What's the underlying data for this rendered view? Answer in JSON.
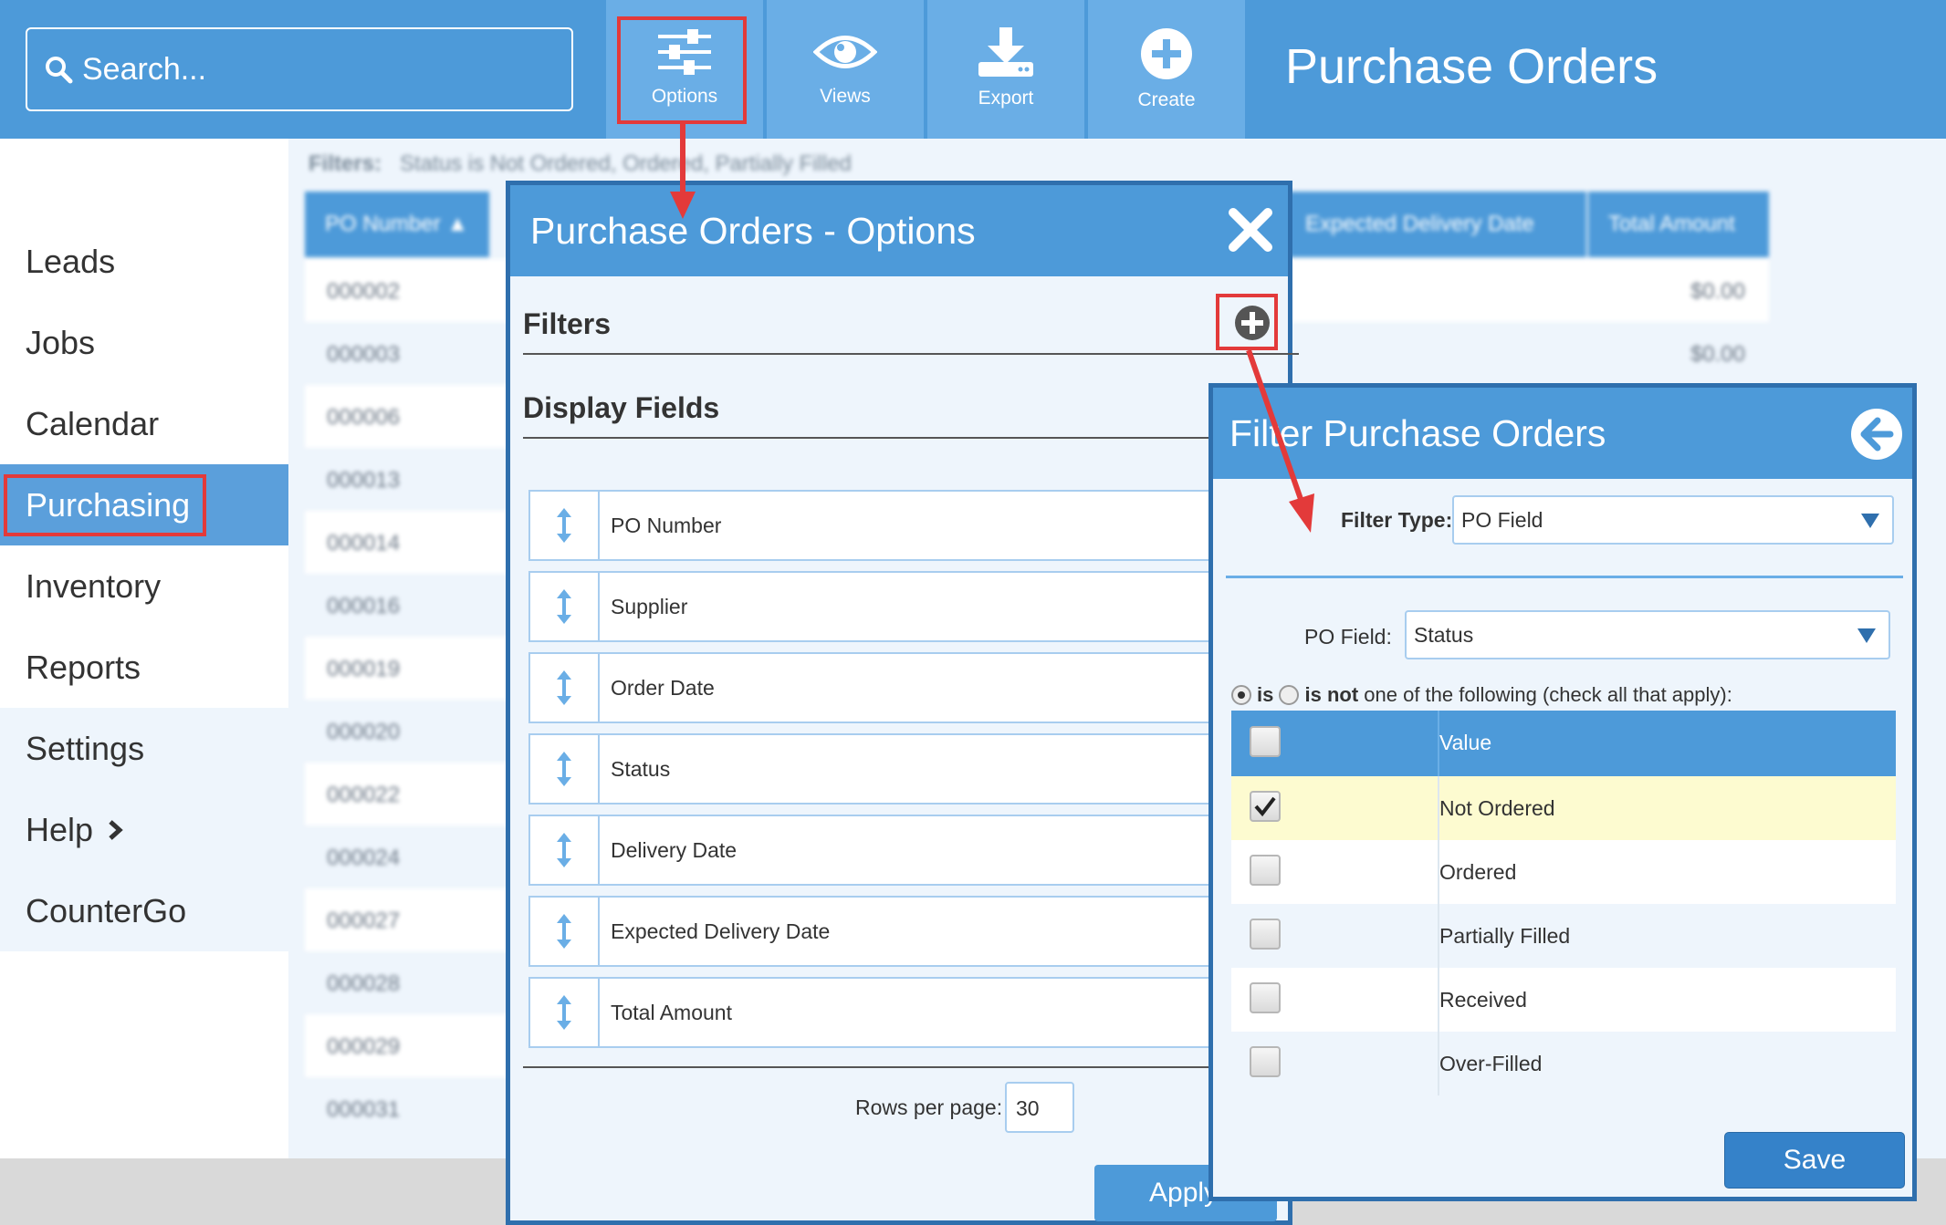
{
  "header": {
    "search_placeholder": "Search...",
    "toolbar": [
      {
        "id": "options",
        "label": "Options",
        "icon": "sliders-icon"
      },
      {
        "id": "views",
        "label": "Views",
        "icon": "eye-icon"
      },
      {
        "id": "export",
        "label": "Export",
        "icon": "download-icon"
      },
      {
        "id": "create",
        "label": "Create",
        "icon": "plus-circle-icon"
      }
    ],
    "page_title": "Purchase Orders"
  },
  "sidebar": {
    "items": [
      {
        "label": "Leads"
      },
      {
        "label": "Jobs"
      },
      {
        "label": "Calendar"
      },
      {
        "label": "Purchasing",
        "active": true
      },
      {
        "label": "Inventory"
      },
      {
        "label": "Reports"
      },
      {
        "label": "Settings"
      },
      {
        "label": "Help"
      },
      {
        "label": "CounterGo"
      }
    ]
  },
  "background_table": {
    "filters_label": "Filters:",
    "filters_text": "Status is Not Ordered, Ordered, Partially Filled",
    "columns": [
      "PO Number ▲",
      "Expected Delivery Date",
      "Total Amount"
    ],
    "rows": [
      {
        "po": "000002",
        "amount": "$0.00"
      },
      {
        "po": "000003",
        "amount": "$0.00"
      },
      {
        "po": "000006"
      },
      {
        "po": "000013"
      },
      {
        "po": "000014"
      },
      {
        "po": "000016"
      },
      {
        "po": "000019"
      },
      {
        "po": "000020"
      },
      {
        "po": "000022"
      },
      {
        "po": "000024"
      },
      {
        "po": "000027"
      },
      {
        "po": "000028"
      },
      {
        "po": "000029"
      },
      {
        "po": "000031"
      }
    ]
  },
  "options_dialog": {
    "title": "Purchase Orders - Options",
    "filters_title": "Filters",
    "display_fields_title": "Display Fields",
    "fields": [
      "PO Number",
      "Supplier",
      "Order Date",
      "Status",
      "Delivery Date",
      "Expected Delivery Date",
      "Total Amount"
    ],
    "rows_per_page_label": "Rows per page:",
    "rows_per_page_value": "30",
    "apply_label": "Apply"
  },
  "filter_dialog": {
    "title": "Filter Purchase Orders",
    "filter_type_label": "Filter Type:",
    "filter_type_value": "PO Field",
    "po_field_label": "PO Field:",
    "po_field_value": "Status",
    "is_label": "is",
    "is_not_label": "is not",
    "instruction": " one of the following (check all that apply):",
    "value_header": "Value",
    "values": [
      {
        "label": "Not Ordered",
        "checked": true
      },
      {
        "label": "Ordered",
        "checked": false
      },
      {
        "label": "Partially Filled",
        "checked": false
      },
      {
        "label": "Received",
        "checked": false
      },
      {
        "label": "Over-Filled",
        "checked": false
      }
    ],
    "save_label": "Save"
  },
  "colors": {
    "header_blue": "#4d9ad9",
    "toolbar_button": "#6aaee6",
    "dialog_border": "#2f6fad",
    "panel_bg": "#eef5fc",
    "highlight_row": "#fdfbd0",
    "callout_red": "#e33a3a"
  }
}
